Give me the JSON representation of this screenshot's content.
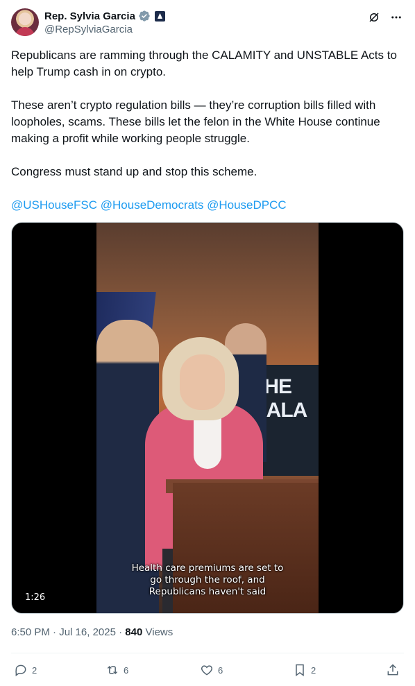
{
  "author": {
    "name": "Rep. Sylvia Garcia",
    "handle": "@RepSylviaGarcia",
    "verified_icon": "verified-badge-icon",
    "gov_icon": "government-badge-icon"
  },
  "header_icons": [
    "grok-icon",
    "more-icon"
  ],
  "tweet": {
    "paragraph1": "Republicans are ramming through the CALAMITY and UNSTABLE Acts to help Trump cash in on crypto.",
    "paragraph2": "These aren’t crypto regulation bills — they’re corruption bills filled with loopholes, scams. These bills let the felon in the White House continue making a profit while working people struggle.",
    "paragraph3": "Congress must stand up and stop this scheme.",
    "mentions": [
      "@USHouseFSC",
      "@HouseDemocrats",
      "@HouseDPCC"
    ]
  },
  "video": {
    "banner_text": "THE CALA",
    "caption_line1": "Health care premiums are set to",
    "caption_line2": "go through the roof, and",
    "caption_line3": "Republicans haven't said",
    "duration": "1:26"
  },
  "meta": {
    "time": "6:50 PM",
    "separator": "·",
    "date": "Jul 16, 2025",
    "views_count": "840",
    "views_label": "Views"
  },
  "actions": {
    "replies": "2",
    "reposts": "6",
    "likes": "6",
    "bookmarks": "2"
  },
  "colors": {
    "link": "#1d9bf0",
    "secondary_text": "#536471",
    "primary_text": "#0f1419"
  }
}
